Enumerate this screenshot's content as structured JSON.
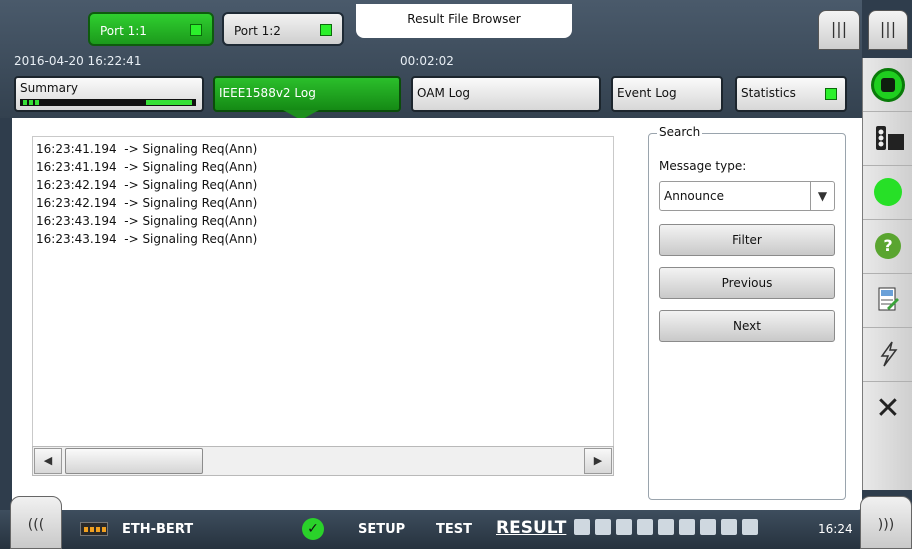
{
  "header": {
    "ports": [
      {
        "label": "Port 1:1",
        "active": true
      },
      {
        "label": "Port 1:2",
        "active": false
      }
    ],
    "result_file_browser": "Result File Browser",
    "datetime": "2016-04-20 16:22:41",
    "elapsed": "00:02:02",
    "corner_tabs": [
      "|||",
      "|||"
    ]
  },
  "tabs": [
    {
      "label": "Summary"
    },
    {
      "label": "IEEE1588v2 Log",
      "active": true
    },
    {
      "label": "OAM Log"
    },
    {
      "label": "Event Log"
    },
    {
      "label": "Statistics"
    }
  ],
  "log": {
    "lines": [
      "16:23:41.194  -> Signaling Req(Ann)",
      "16:23:41.194  -> Signaling Req(Ann)",
      "16:23:42.194  -> Signaling Req(Ann)",
      "16:23:42.194  -> Signaling Req(Ann)",
      "16:23:43.194  -> Signaling Req(Ann)",
      "16:23:43.194  -> Signaling Req(Ann)"
    ]
  },
  "search": {
    "legend": "Search",
    "message_type_label": "Message type:",
    "message_type_value": "Announce",
    "filter_label": "Filter",
    "previous_label": "Previous",
    "next_label": "Next"
  },
  "sidebar": {
    "icons": [
      "start-stop-icon",
      "traffic-light-icon",
      "status-led-icon",
      "help-icon",
      "report-icon",
      "inject-error-icon",
      "close-icon"
    ]
  },
  "bottom": {
    "left_tab": "(((",
    "right_tab": ")))",
    "app_name": "ETH-BERT",
    "setup": "SETUP",
    "test": "TEST",
    "result": "RESULT",
    "clock": "16:24"
  },
  "colors": {
    "active_green": "#1d9a1d",
    "led_green": "#2bf02b",
    "header_bg": "#3b4a59"
  }
}
